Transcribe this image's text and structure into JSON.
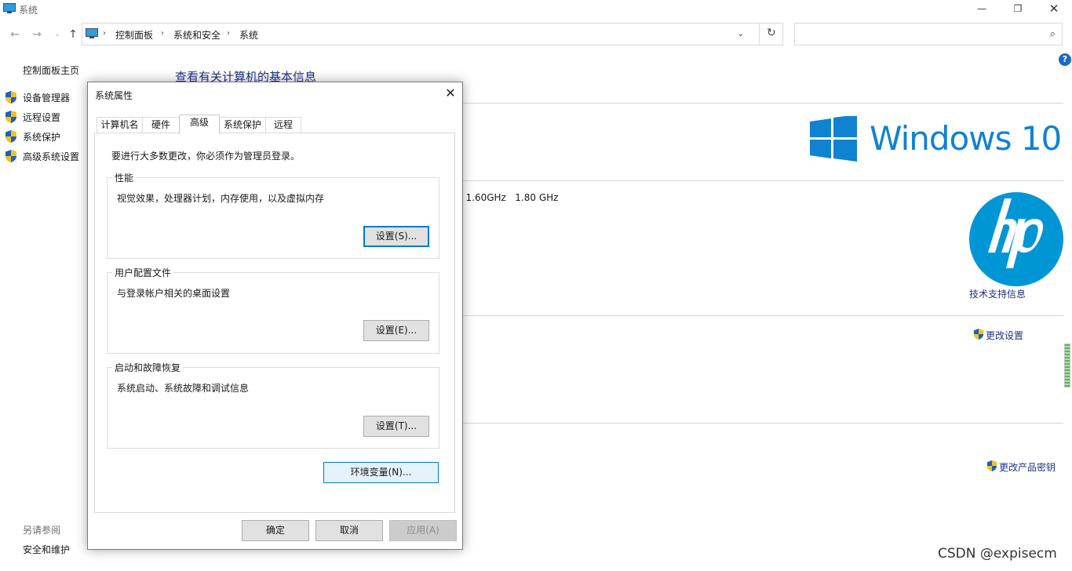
{
  "window": {
    "title": "系统",
    "min_label": "—",
    "max_label": "❐",
    "close_label": "✕"
  },
  "nav": {
    "back": "←",
    "forward": "→",
    "recent": "⌄",
    "up": "↑",
    "breadcrumb": [
      "控制面板",
      "系统和安全",
      "系统"
    ],
    "separator": "›",
    "dropdown": "⌄",
    "refresh": "↻",
    "search_placeholder": "",
    "search_glyph": "⌕"
  },
  "left": {
    "home": "控制面板主页",
    "tasks": [
      "设备管理器",
      "远程设置",
      "系统保护",
      "高级系统设置"
    ],
    "see_also": "另请参阅",
    "see_also_link": "安全和维护"
  },
  "main": {
    "title": "查看有关计算机的基本信息",
    "windows_brand": "Windows 10",
    "cpu": ") 1.60GHz   1.80 GHz",
    "support_link": "技术支持信息",
    "change_settings": "更改设置",
    "change_key": "更改产品密钥",
    "help": "?"
  },
  "dialog": {
    "title": "系统属性",
    "close": "✕",
    "tabs": [
      "计算机名",
      "硬件",
      "高级",
      "系统保护",
      "远程"
    ],
    "active_tab": "高级",
    "notice": "要进行大多数更改，你必须作为管理员登录。",
    "groups": [
      {
        "legend": "性能",
        "desc": "视觉效果，处理器计划，内存使用，以及虚拟内存",
        "button": "设置(S)..."
      },
      {
        "legend": "用户配置文件",
        "desc": "与登录帐户相关的桌面设置",
        "button": "设置(E)..."
      },
      {
        "legend": "启动和故障恢复",
        "desc": "系统启动、系统故障和调试信息",
        "button": "设置(T)..."
      }
    ],
    "env_button": "环境变量(N)...",
    "ok": "确定",
    "cancel": "取消",
    "apply": "应用(A)"
  },
  "watermark": "CSDN @expisecm",
  "colors": {
    "link": "#1e3287",
    "windows_blue": "#0f82d2",
    "hp_blue": "#0096d6",
    "focus_blue": "#0078d7"
  }
}
